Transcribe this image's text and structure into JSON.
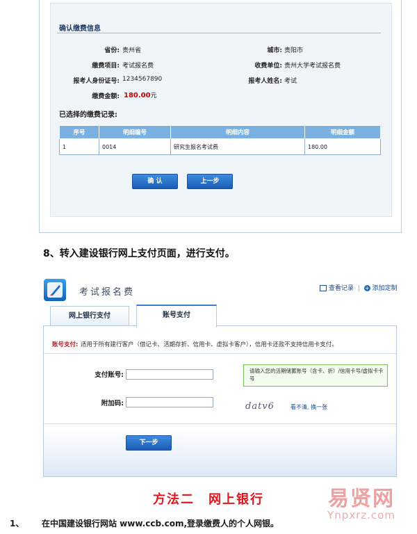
{
  "confirm": {
    "title": "确认缴费信息",
    "fields": {
      "province_label": "省份:",
      "province": "贵州省",
      "city_label": "城市:",
      "city": "贵阳市",
      "item_label": "缴费项目:",
      "item": "考试报名费",
      "payee_label": "收费单位:",
      "payee": "贵州大学考试报名费",
      "id_label": "报考人身份证号:",
      "id": "1234567890",
      "name_label": "报考人姓名:",
      "name": "考试",
      "amount_label": "缴费金额:",
      "amount": "180.00",
      "amount_unit": "元"
    },
    "selected_title": "已选择的缴费记录:",
    "table": {
      "headers": [
        "序号",
        "明细编号",
        "明细内容",
        "明细金额"
      ],
      "rows": [
        [
          "1",
          "0014",
          "研究生报名考试费",
          "180.00"
        ]
      ]
    },
    "confirm_button": "确 认",
    "back_button": "上一步"
  },
  "step8": "8、转入建设银行网上支付页面，进行支付。",
  "bank": {
    "title": "考试报名费",
    "link_records": "查看记录",
    "link_sep": "|",
    "link_custom": "添加定制",
    "tab_online": "网上银行支付",
    "tab_account": "账号支付",
    "note_label": "账号支付:",
    "note": "适用于所有建行客户（借记卡、活期存折、信用卡、虚拟卡客户），信用卡还款不支持信用卡支付。",
    "account_label": "支付账号:",
    "account_hint": "请输入您的活期储蓄账号（含卡、折）/信用卡号/虚拟卡卡号",
    "code_label": "附加码:",
    "captcha": "datv6",
    "captcha_unclear": "看不清",
    "captcha_refresh": "换一张",
    "next_button": "下一步"
  },
  "method2": "方法二　网上银行",
  "step1_num": "1、",
  "step1": "在中国建设银行网站 www.ccb.com,登录缴费人的个人网银。",
  "watermark": {
    "main": "易贤网",
    "sub": "Ynpxrz.com"
  },
  "colors": {
    "accent_red": "#e0161d",
    "amount_red": "#cc0000",
    "table_header": "#7ab1e0",
    "button_blue": "#1a5cb3"
  }
}
